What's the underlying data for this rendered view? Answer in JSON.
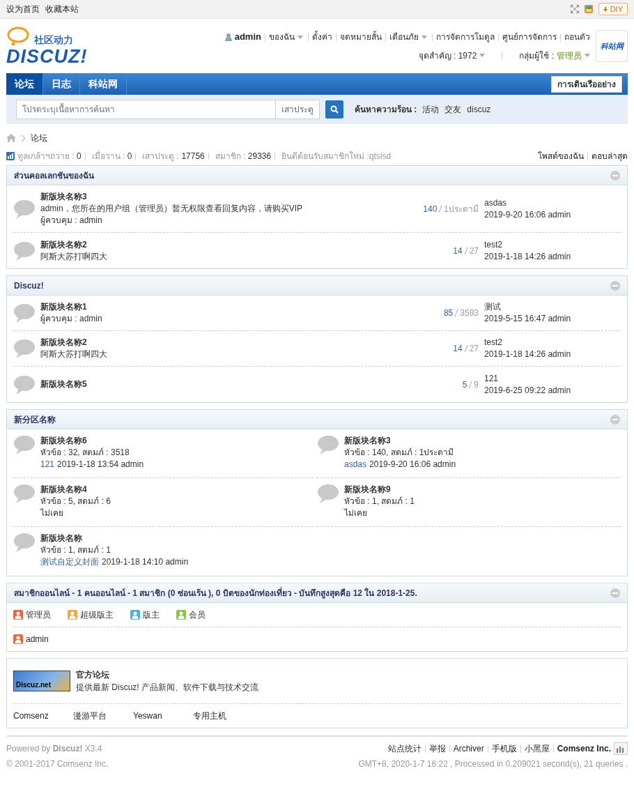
{
  "topbar": {
    "links": [
      "设为首页",
      "收藏本站"
    ],
    "diy": "DIY"
  },
  "header": {
    "logo": {
      "tagline": "社区动力",
      "wordmark": "DISCUZ!"
    },
    "username": "admin",
    "menu": [
      {
        "label": "ของฉัน",
        "dropdown": true
      },
      {
        "label": "ตั้งค่า",
        "dropdown": false
      },
      {
        "label": "จดหมายสั้น",
        "dropdown": false
      },
      {
        "label": "เตือนภัย",
        "dropdown": true
      },
      {
        "label": "การจัดการโมดูล",
        "dropdown": false
      },
      {
        "label": "ศูนย์การจัดการ",
        "dropdown": false
      },
      {
        "label": "ถอนตัว",
        "dropdown": false
      }
    ],
    "credits": "จุดสำคัญ : 1972",
    "group_label": "กลุ่มผู้ใช้ : ",
    "group": "管理员",
    "badge": "科站网"
  },
  "nav": {
    "tabs": [
      {
        "label": "论坛",
        "selected": true
      },
      {
        "label": "日志",
        "selected": false
      },
      {
        "label": "科站网",
        "selected": false
      }
    ],
    "quick_nav": "การเดินเรืออย่าง"
  },
  "search": {
    "placeholder": "โปรดระบุเนื้อหาการค้นหา",
    "type": "เสาประตู",
    "hot_label": "ค้นหาความร้อน :",
    "hot": [
      "活动",
      "交友",
      "discuz"
    ]
  },
  "breadcrumb": [
    "论坛"
  ],
  "stats": {
    "items": [
      {
        "label": "ทูลเกล้าฯถวาย : ",
        "value": "0"
      },
      {
        "label": "เมื่อวาน : ",
        "value": "0"
      },
      {
        "label": "เสาประตู : ",
        "value": "17756"
      },
      {
        "label": "สมาชิก : ",
        "value": "29336"
      }
    ],
    "welcome": "ยินดีต้อนรับสมาชิกใหม่ : ",
    "new_member": "qtsisd",
    "links": [
      "โพสต์ของฉัน",
      "ตอบล่าสุด"
    ]
  },
  "sections": [
    {
      "title": "ส่วนคอลเลกชันของฉัน",
      "kind": "list",
      "forums": [
        {
          "name": "新版块名称3",
          "description": "admin，您所在的用户组（管理员）暂无权限查看回复内容，请购买VIP",
          "moderator_label": "ผู้ควบคุม : ",
          "moderator": "admin",
          "topics": "140",
          "posts": "1ประดามี",
          "last_title": "asdas",
          "last_info": "2019-9-20 16:06 admin"
        },
        {
          "name": "新版块名称2",
          "description": "阿斯大苏打啊四大",
          "topics": "14",
          "posts": "27",
          "last_title": "test2",
          "last_info": "2019-1-18 14:26 admin"
        }
      ]
    },
    {
      "title": "Discuz!",
      "kind": "list",
      "forums": [
        {
          "name": "新版块名称1",
          "moderator_label": "ผู้ควบคุม : ",
          "moderator": "admin",
          "topics": "85",
          "posts": "3593",
          "last_title": "测试",
          "last_info": "2019-5-15 16:47 admin"
        },
        {
          "name": "新版块名称2",
          "description": "阿斯大苏打啊四大",
          "topics": "14",
          "posts": "27",
          "last_title": "test2",
          "last_info": "2019-1-18 14:26 admin"
        },
        {
          "name": "新版块名称5",
          "topics": "5",
          "posts": "9",
          "last_title": "121",
          "last_info": "2019-6-25 09:22 admin"
        }
      ]
    },
    {
      "title": "新分区名称",
      "kind": "grid",
      "forums": [
        {
          "name": "新版块名称6",
          "counts": "หัวข้อ : 32, สดมภ์ : 3518",
          "last_title": "121",
          "last_info": "2019-1-18 13:54 admin"
        },
        {
          "name": "新版块名称3",
          "counts": "หัวข้อ : 140, สดมภ์ : 1ประดามี",
          "last_title": "asdas",
          "last_info": "2019-9-20 16:06 admin"
        },
        {
          "name": "新版块名称4",
          "counts": "หัวข้อ : 5, สดมภ์ : 6",
          "last_info": "ไม่เคย"
        },
        {
          "name": "新版块名称9",
          "counts": "หัวข้อ : 1, สดมภ์ : 1",
          "last_info": "ไม่เคย"
        },
        {
          "name": "新版块名称",
          "counts": "หัวข้อ : 1, สดมภ์ : 1",
          "last_title": "测试自定义封面",
          "last_info": "2019-1-18 14:10 admin"
        }
      ]
    }
  ],
  "online": {
    "title": "สมาชิกออนไลน์ - 1 คนออนไลน์ - 1 สมาชิก (0 ซ่อนเร้น ), 0 บิตของนักท่องเที่ยว - บันทึกสูงสุดคือ 12 ใน 2018-1-25.",
    "legend": [
      {
        "label": "管理员",
        "color": "#e8683a"
      },
      {
        "label": "超级版主",
        "color": "#f0a848"
      },
      {
        "label": "版主",
        "color": "#4ab0e0"
      },
      {
        "label": "会员",
        "color": "#8cc63f"
      }
    ],
    "users": [
      {
        "name": "admin",
        "color": "#e8683a"
      }
    ]
  },
  "links": {
    "featured": {
      "logo": "Discuz.net",
      "name": "官方论坛",
      "description": "提供最新 Discuz! 产品新闻、软件下载与技术交流"
    },
    "text_links": [
      "Comsenz",
      "漫游平台",
      "Yeswan",
      "专用主机"
    ]
  },
  "footer": {
    "powered": "Powered by **Discuz!** X3.4",
    "copyright": "© 2001-2017 Comsenz Inc.",
    "links": [
      {
        "label": "站点统计",
        "strong": false
      },
      {
        "label": "举报",
        "strong": false
      },
      {
        "label": "Archiver",
        "strong": false
      },
      {
        "label": "手机版",
        "strong": false
      },
      {
        "label": "小黑屋",
        "strong": false
      },
      {
        "label": "Comsenz Inc.",
        "strong": true
      }
    ],
    "info": "GMT+8, 2020-1-7 16:22 , Processed in 0.209021 second(s), 21 queries ."
  }
}
